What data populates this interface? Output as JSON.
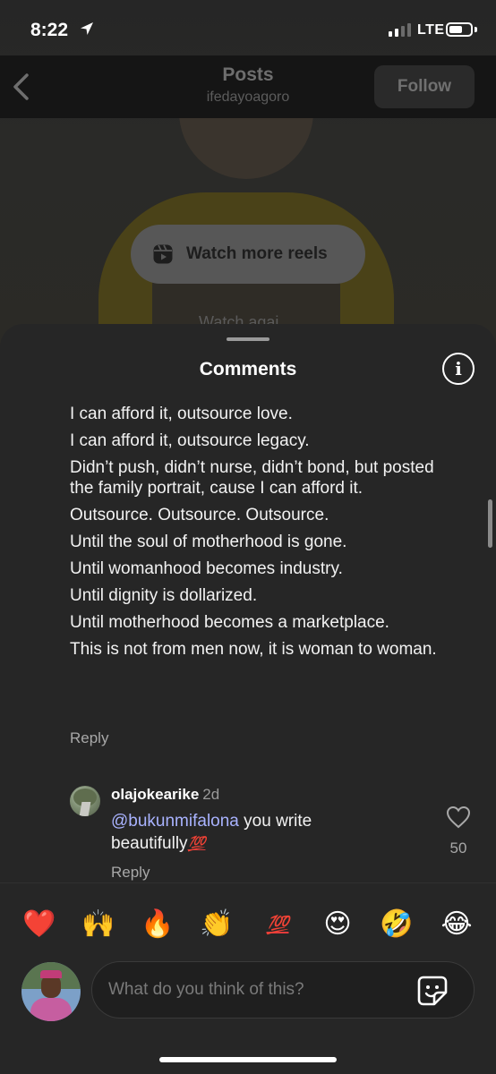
{
  "status_bar": {
    "time": "8:22",
    "network": "LTE"
  },
  "header": {
    "title": "Posts",
    "username": "ifedayoagoro",
    "follow_label": "Follow"
  },
  "reel": {
    "watch_more_label": "Watch more reels",
    "ghost_text": "Watch agai"
  },
  "comments_sheet": {
    "title": "Comments",
    "main_comment": {
      "lines": [
        "I can afford it, outsource love.",
        "I can afford it, outsource legacy.",
        "Didn’t push, didn’t nurse, didn’t bond, but posted the family portrait, cause I can afford it.",
        "Outsource. Outsource. Outsource.",
        "Until the soul of motherhood is gone.",
        "Until womanhood becomes industry.",
        "Until dignity is dollarized.",
        "Until motherhood becomes a marketplace.",
        "This is not from men now, it is woman to woman."
      ],
      "reply_label": "Reply"
    },
    "reply_comment": {
      "username": "olajokearike",
      "age": "2d",
      "mention": "@bukunmifalona",
      "text": " you write beautifully",
      "emoji": "💯",
      "reply_label": "Reply",
      "like_count": "50"
    }
  },
  "emoji_bar": [
    "❤️",
    "🙌",
    "🔥",
    "👏",
    "💯",
    "😍",
    "🤣",
    "😂"
  ],
  "composer": {
    "placeholder": "What do you think of this?"
  }
}
